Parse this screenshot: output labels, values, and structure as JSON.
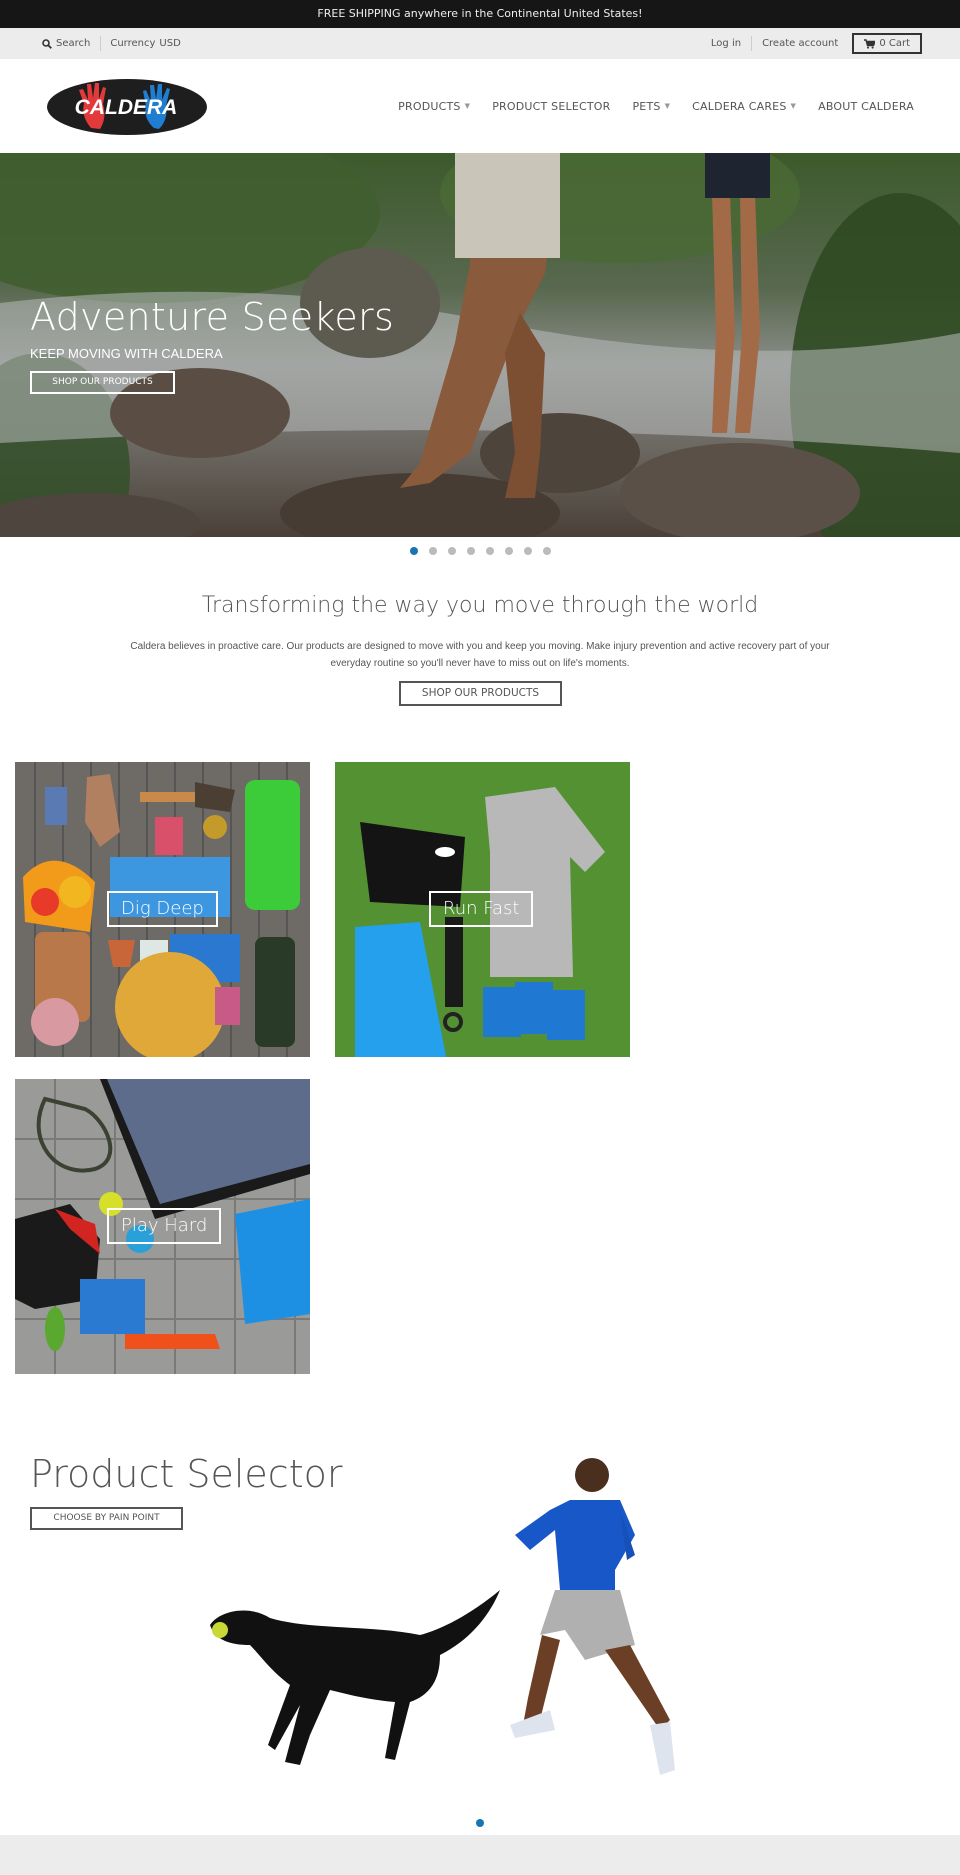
{
  "promo": {
    "text": "FREE SHIPPING anywhere in the Continental United States!"
  },
  "utility": {
    "search_label": "Search",
    "currency_label": "Currency",
    "currency_value": "USD",
    "login_label": "Log in",
    "create_account_label": "Create account",
    "cart_label": "0 Cart"
  },
  "header": {
    "logo_text": "CALDERA",
    "nav": [
      {
        "label": "PRODUCTS",
        "has_dropdown": true
      },
      {
        "label": "PRODUCT SELECTOR",
        "has_dropdown": false
      },
      {
        "label": "PETS",
        "has_dropdown": true
      },
      {
        "label": "CALDERA CARES",
        "has_dropdown": true
      },
      {
        "label": "ABOUT CALDERA",
        "has_dropdown": false
      }
    ],
    "caret": "▼"
  },
  "hero": {
    "title": "Adventure Seekers",
    "subtitle": "KEEP MOVING WITH CALDERA",
    "button_label": "SHOP OUR PRODUCTS",
    "slide_count": 8,
    "active_slide": 1
  },
  "intro": {
    "title": "Transforming the way you move through the world",
    "text": "Caldera believes in proactive care. Our products are designed to move with you and keep you moving. Make injury prevention and active recovery part of your everyday routine so you'll never have to miss out on life's moments.",
    "button_label": "SHOP OUR PRODUCTS"
  },
  "collections": [
    {
      "label": "Dig Deep"
    },
    {
      "label": "Run Fast"
    },
    {
      "label": "Play Hard"
    }
  ],
  "product_selector": {
    "title": "Product Selector",
    "button_label": "CHOOSE BY PAIN POINT",
    "slide_count": 1,
    "active_slide": 1
  },
  "colors": {
    "accent": "#1a73b3",
    "promo_bg": "#161616",
    "util_bg": "#ececec",
    "logo_red": "#e23a3a",
    "logo_blue": "#1f7ed0"
  }
}
